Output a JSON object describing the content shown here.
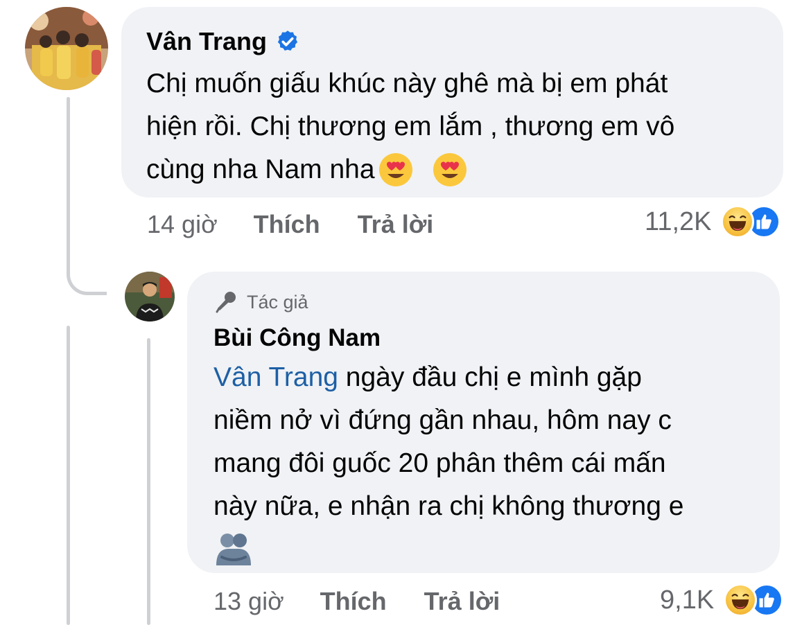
{
  "thread": {
    "comment": {
      "author": "Vân Trang",
      "verified": true,
      "text_lines": [
        "Chị muốn giấu khúc này ghê mà bị em phát",
        "hiện rồi. Chị thương em lắm , thương em vô",
        "cùng nha Nam nha"
      ],
      "emojis": [
        "heart-eyes",
        "heart-eyes"
      ],
      "time": "14 giờ",
      "like_label": "Thích",
      "reply_label": "Trả lời",
      "reaction_count": "11,2K",
      "reactions": [
        "haha",
        "like"
      ]
    },
    "reply": {
      "badge": "Tác giả",
      "author": "Bùi Công Nam",
      "mention": "Vân Trang",
      "text_first_line": " ngày đầu chị e mình gặp",
      "text_lines": [
        "niềm nở vì đứng gần nhau, hôm nay c",
        "mang đôi guốc 20 phân thêm cái mấn",
        "này nữa, e nhận ra chị không thương e"
      ],
      "emojis": [
        "people-hugging"
      ],
      "time": "13 giờ",
      "like_label": "Thích",
      "reply_label": "Trả lời",
      "reaction_count": "9,1K",
      "reactions": [
        "haha",
        "like"
      ]
    }
  },
  "colors": {
    "bubble": "#f0f2f5",
    "secondary_text": "#65676b",
    "mention": "#1d5fa5",
    "like_blue": "#1877f2",
    "verified_blue": "#1b74e4"
  }
}
